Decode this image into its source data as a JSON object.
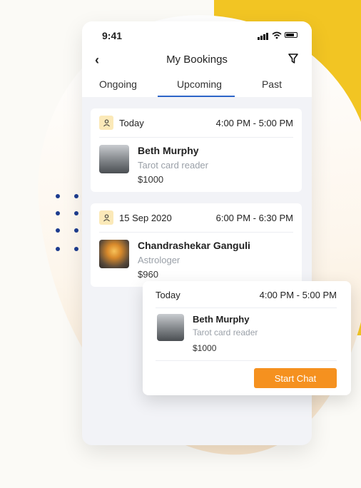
{
  "status_bar": {
    "time": "9:41"
  },
  "header": {
    "title": "My Bookings"
  },
  "tabs": [
    {
      "label": "Ongoing",
      "active": false
    },
    {
      "label": "Upcoming",
      "active": true
    },
    {
      "label": "Past",
      "active": false
    }
  ],
  "bookings": [
    {
      "date": "Today",
      "time": "4:00 PM - 5:00 PM",
      "name": "Beth Murphy",
      "role": "Tarot card reader",
      "price": "$1000"
    },
    {
      "date": "15 Sep 2020",
      "time": "6:00 PM - 6:30 PM",
      "name": "Chandrashekar Ganguli",
      "role": "Astrologer",
      "price": "$960"
    }
  ],
  "popup": {
    "date": "Today",
    "time": "4:00 PM - 5:00 PM",
    "name": "Beth Murphy",
    "role": "Tarot card reader",
    "price": "$1000",
    "button_label": "Start Chat"
  },
  "colors": {
    "accent_blue": "#2d65c8",
    "accent_orange": "#f5911f",
    "background_yellow": "#f2c523",
    "dot_navy": "#1d3c8f"
  },
  "icons": [
    "back-chevron-icon",
    "filter-icon",
    "signal-icon",
    "wifi-icon",
    "battery-icon",
    "user-icon"
  ]
}
